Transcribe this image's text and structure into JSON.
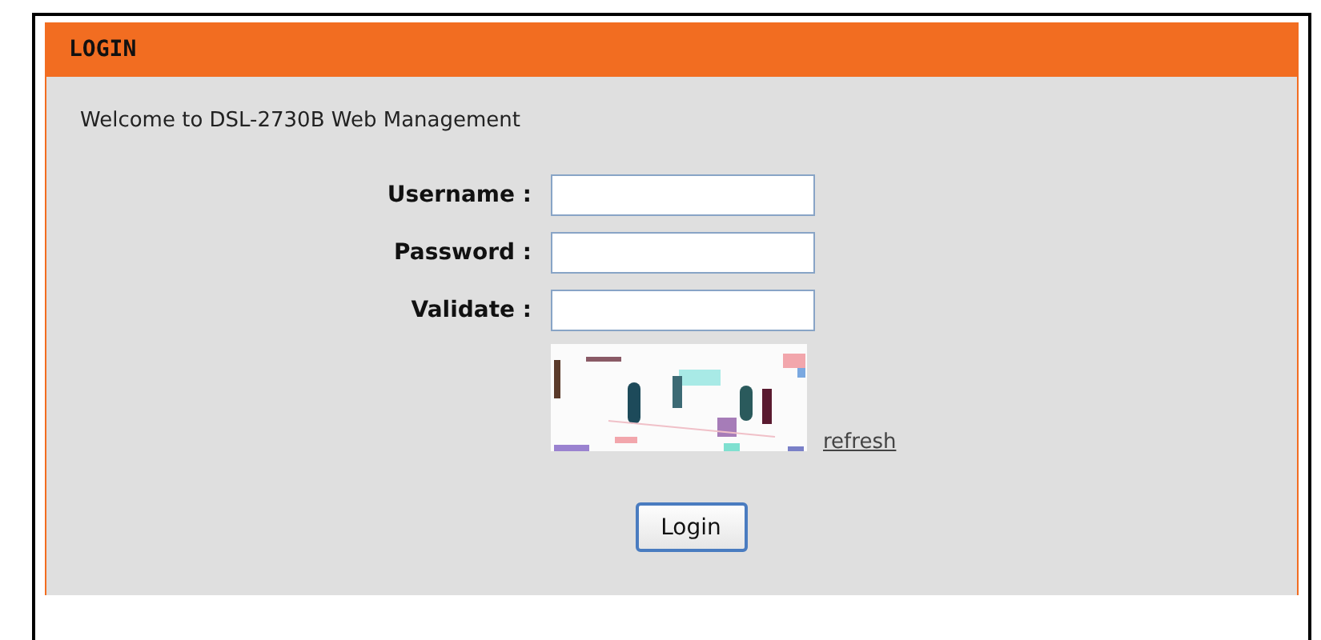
{
  "panel": {
    "title": "LOGIN",
    "welcome": "Welcome to DSL-2730B Web Management"
  },
  "fields": [
    {
      "label": "Username :"
    },
    {
      "label": "Password :"
    },
    {
      "label": "Validate :"
    }
  ],
  "captcha": {
    "kind": "picture",
    "refresh_link": "refresh"
  },
  "login_button": "Login"
}
